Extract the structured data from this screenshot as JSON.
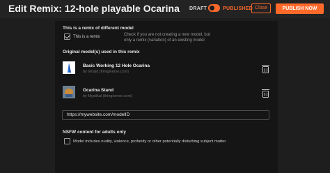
{
  "header": {
    "title": "Edit Remix: 12-hole playable Ocarina",
    "draft_label": "DRAFT",
    "published_label": "PUBLISHED",
    "close_label": "Close",
    "publish_label": "PUBLISH NOW",
    "toggle_state": "published"
  },
  "remix": {
    "heading": "This is a remix of different model",
    "checkbox_label": "This is a remix",
    "checked": true,
    "help_line1": "Check if you are not creating a new model, but",
    "help_line2": "only a remix (variation) of an existing model",
    "originals_heading": "Original model(s) used in this remix",
    "models": [
      {
        "name": "Basic Working 12 Hole Ocarina",
        "by": "by rimaid (thingiverse.com)"
      },
      {
        "name": "Ocarina Stand",
        "by": "by Mystikal (thingiverse.com)"
      }
    ],
    "url_value": "https://mywebsite.com/modelID"
  },
  "nsfw": {
    "heading": "NSFW content for adults only",
    "checkbox_label": "Model includes nudity, violence, profanity or other potentially disturbing subject matter.",
    "checked": false
  },
  "colors": {
    "accent": "#ff6a2b",
    "background": "#1e1e1f",
    "panel": "#151516"
  }
}
